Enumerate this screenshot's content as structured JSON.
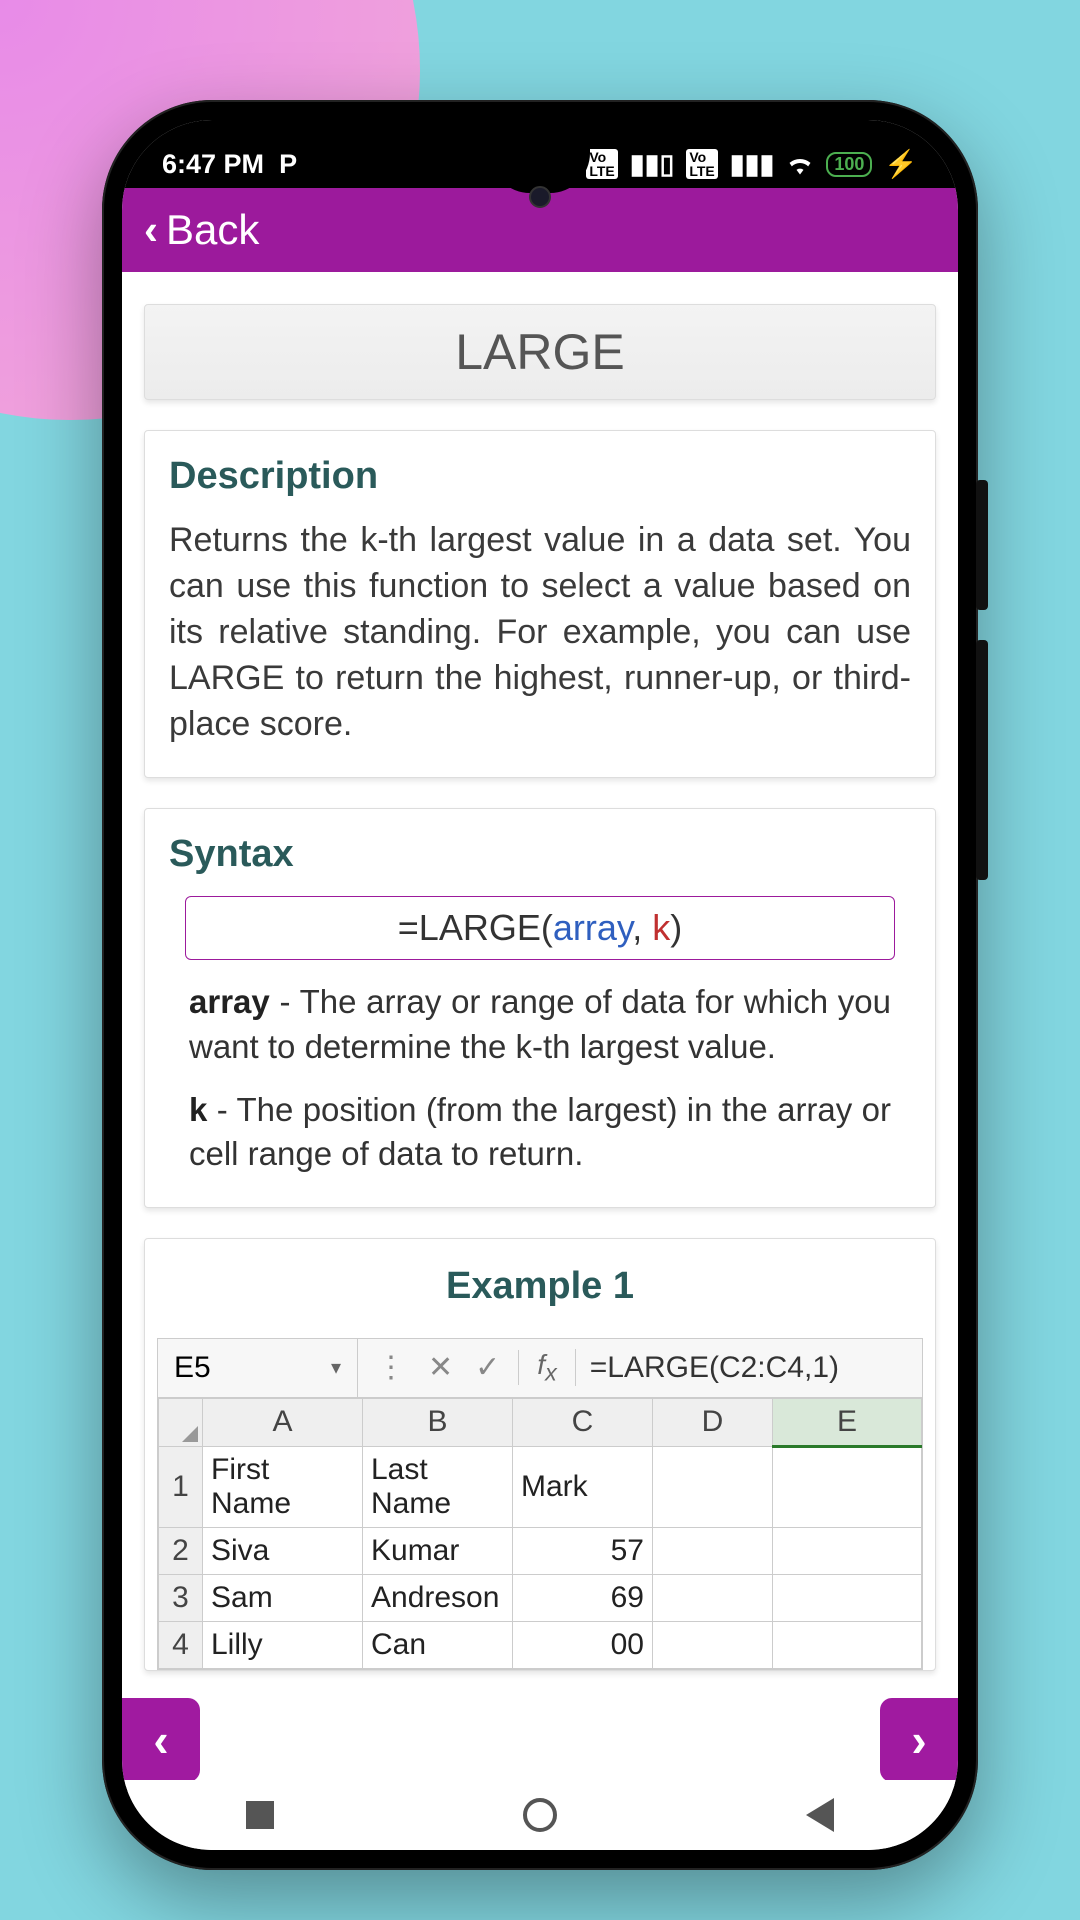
{
  "status": {
    "time": "6:47 PM",
    "app_indicator": "P",
    "battery": "100"
  },
  "topbar": {
    "back_label": "Back"
  },
  "page": {
    "title": "LARGE",
    "description_heading": "Description",
    "description_text": "Returns the k-th largest value in a data set. You can use this function to select a value based on its relative standing. For example, you can use LARGE to return the highest, runner-up, or third-place score.",
    "syntax_heading": "Syntax",
    "syntax": {
      "prefix": "=",
      "fn": "LARGE",
      "open": "(",
      "arg1": "array",
      "comma": ", ",
      "arg2": "k",
      "close": ")"
    },
    "param_array_name": "array",
    "param_array_text": " - The array or range of data for which you want to determine the k-th largest value.",
    "param_k_name": "k",
    "param_k_text": " - The position (from the largest) in the array or cell range of data to return.",
    "example_heading": "Example 1"
  },
  "excel": {
    "namebox": "E5",
    "formula": "=LARGE(C2:C4,1)",
    "columns": [
      "A",
      "B",
      "C",
      "D",
      "E"
    ],
    "rows": [
      {
        "n": "1",
        "a": "First Name",
        "b": "Last Name",
        "c": "Mark",
        "d": "",
        "e": ""
      },
      {
        "n": "2",
        "a": "Siva",
        "b": "Kumar",
        "c": "57",
        "d": "",
        "e": ""
      },
      {
        "n": "3",
        "a": "Sam",
        "b": "Andreson",
        "c": "69",
        "d": "",
        "e": ""
      },
      {
        "n": "4",
        "a": "Lilly",
        "b": "Can",
        "c": "00",
        "d": "",
        "e": ""
      }
    ]
  }
}
